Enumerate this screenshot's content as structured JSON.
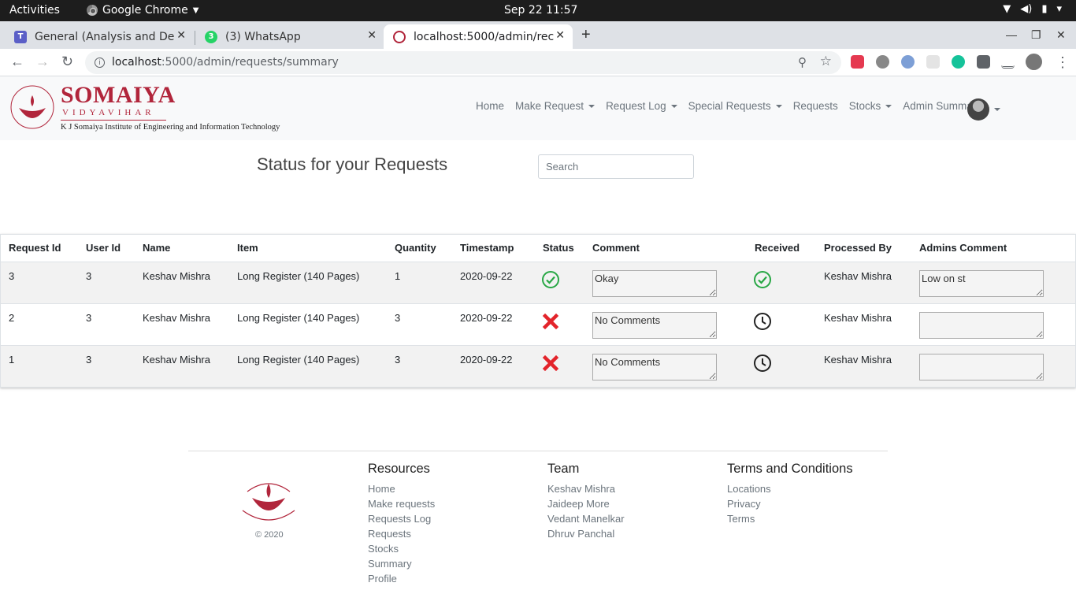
{
  "os_bar": {
    "activities": "Activities",
    "app_name": "Google Chrome",
    "clock": "Sep 22  11:57"
  },
  "browser": {
    "tabs": [
      {
        "title": "General (Analysis and Des",
        "icon": "teams-icon"
      },
      {
        "title": "(3) WhatsApp",
        "icon": "whatsapp-icon",
        "badge": "3"
      },
      {
        "title": "localhost:5000/admin/rec",
        "icon": "somaiya-favicon",
        "active": true
      }
    ],
    "url_host": "localhost",
    "url_rest": ":5000/admin/requests/summary"
  },
  "site": {
    "brand": "SOMAIYA",
    "brand_sub": "VIDYAVIHAR",
    "institute": "K J Somaiya Institute of Engineering and Information Technology",
    "menu": [
      {
        "label": "Home",
        "dropdown": false
      },
      {
        "label": "Make Request",
        "dropdown": true
      },
      {
        "label": "Request Log",
        "dropdown": true
      },
      {
        "label": "Special Requests",
        "dropdown": true
      },
      {
        "label": "Requests",
        "dropdown": false
      },
      {
        "label": "Stocks",
        "dropdown": true
      },
      {
        "label": "Admin Summary",
        "dropdown": false
      }
    ]
  },
  "main": {
    "title": "Status for your Requests",
    "search_placeholder": "Search",
    "columns": [
      "Request Id",
      "User Id",
      "Name",
      "Item",
      "Quantity",
      "Timestamp",
      "Status",
      "Comment",
      "Received",
      "Processed By",
      "Admins Comment"
    ],
    "rows": [
      {
        "request_id": "3",
        "user_id": "3",
        "name": "Keshav Mishra",
        "item": "Long Register (140 Pages)",
        "quantity": "1",
        "timestamp": "2020-09-22",
        "status": "approved-check-icon",
        "comment": "Okay",
        "received": "received-check-icon",
        "processed_by": "Keshav Mishra",
        "admins_comment": "Low on st"
      },
      {
        "request_id": "2",
        "user_id": "3",
        "name": "Keshav Mishra",
        "item": "Long Register (140 Pages)",
        "quantity": "3",
        "timestamp": "2020-09-22",
        "status": "rejected-cross-icon",
        "comment": "No Comments",
        "received": "pending-clock-icon",
        "processed_by": "Keshav Mishra",
        "admins_comment": ""
      },
      {
        "request_id": "1",
        "user_id": "3",
        "name": "Keshav Mishra",
        "item": "Long Register (140 Pages)",
        "quantity": "3",
        "timestamp": "2020-09-22",
        "status": "rejected-cross-icon",
        "comment": "No Comments",
        "received": "pending-clock-icon",
        "processed_by": "Keshav Mishra",
        "admins_comment": ""
      }
    ]
  },
  "footer": {
    "copyright": "© 2020",
    "resources": {
      "title": "Resources",
      "links": [
        "Home",
        "Make requests",
        "Requests Log",
        "Requests",
        "Stocks",
        "Summary",
        "Profile"
      ]
    },
    "team": {
      "title": "Team",
      "links": [
        "Keshav Mishra",
        "Jaideep More",
        "Vedant Manelkar",
        "Dhruv Panchal"
      ]
    },
    "terms": {
      "title": "Terms and Conditions",
      "links": [
        "Locations",
        "Privacy",
        "Terms"
      ]
    }
  },
  "colors": {
    "brand": "#b1253b",
    "ok": "#28a745",
    "reject": "#e3242b"
  }
}
